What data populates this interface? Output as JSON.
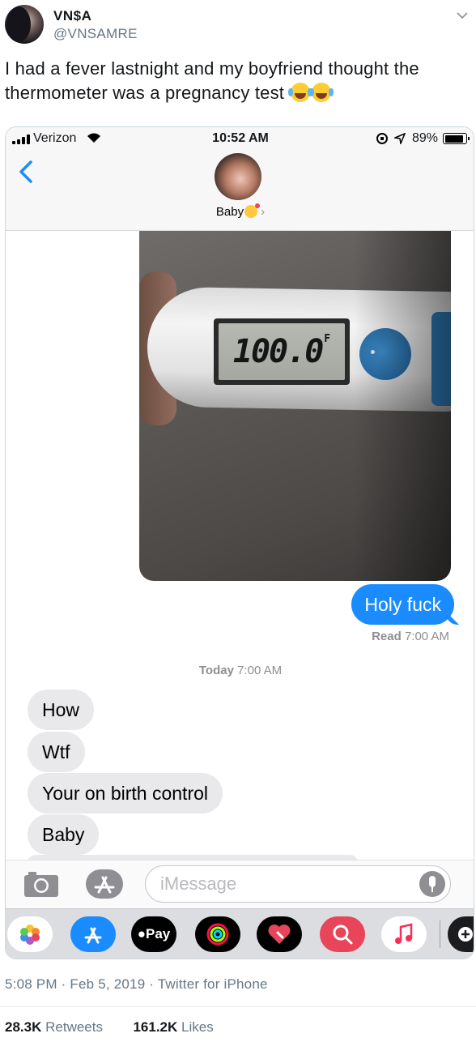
{
  "tweet": {
    "display_name": "VN$A",
    "handle": "@VNSAMRE",
    "text": "I had a fever lastnight and my boyfriend thought the thermometer was a pregnancy test",
    "emoji": "face-with-tears-of-joy x2",
    "meta": "5:08 PM · Feb 5, 2019 · Twitter for iPhone",
    "retweets_count": "28.3K",
    "retweets_label": "Retweets",
    "likes_count": "161.2K",
    "likes_label": "Likes"
  },
  "status_bar": {
    "carrier": "Verizon",
    "time": "10:52 AM",
    "battery": "89%"
  },
  "conversation": {
    "contact_name": "Baby",
    "thermometer_reading": "100.0",
    "thermometer_unit": "F",
    "outgoing": [
      "Holy fuck"
    ],
    "read_label": "Read",
    "read_time": "7:00 AM",
    "day_label": "Today",
    "day_time": "7:00 AM",
    "incoming": [
      "How",
      "Wtf",
      "Your on birth control",
      "Baby"
    ]
  },
  "composer": {
    "placeholder": "iMessage"
  },
  "app_drawer": {
    "pay_label": "Pay",
    "apps": [
      "photos-icon",
      "app-store-icon",
      "apple-pay-icon",
      "activity-icon",
      "digital-touch-icon",
      "search-images-icon",
      "music-icon",
      "more-apps-icon"
    ]
  },
  "colors": {
    "imessage_blue": "#1a8cff",
    "incoming_gray": "#e9e9eb",
    "twitter_gray": "#657786"
  }
}
